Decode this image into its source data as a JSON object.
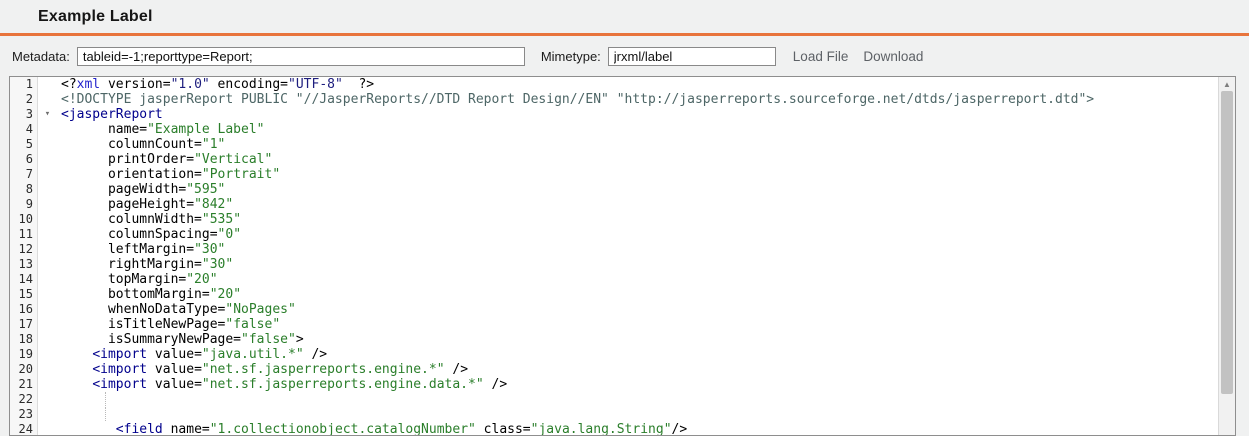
{
  "page": {
    "title": "Example Label",
    "accent_color": "#e8743c",
    "background_color": "#f0f1f1"
  },
  "toolbar": {
    "metadata_label": "Metadata:",
    "metadata_value": "tableid=-1;reporttype=Report;",
    "mimetype_label": "Mimetype:",
    "mimetype_value": "jrxml/label",
    "load_file_label": "Load File",
    "download_label": "Download"
  },
  "editor": {
    "language": "xml",
    "syntax_colors": {
      "tag": "#00008c",
      "attribute": "#000000",
      "string": "#2a7e2a",
      "doctype": "#4d6666",
      "pi_keyword": "#2323cc",
      "pi_string": "#1d1d7e",
      "plain": "#000000"
    },
    "icons": {
      "fold_arrow": "▾",
      "scroll_up": "▲"
    },
    "lines": [
      {
        "num": 1,
        "segs": [
          [
            "<?",
            "pl"
          ],
          [
            "xml",
            "pi"
          ],
          [
            " version=",
            "pl"
          ],
          [
            "\"1.0\"",
            "pistr"
          ],
          [
            " encoding=",
            "pl"
          ],
          [
            "\"UTF-8\"",
            "pistr"
          ],
          [
            "  ?>",
            "pl"
          ]
        ]
      },
      {
        "num": 2,
        "segs": [
          [
            "<!DOCTYPE jasperReport PUBLIC \"//JasperReports//DTD Report Design//EN\" \"http://jasperreports.sourceforge.net/dtds/jasperreport.dtd\">",
            "doc"
          ]
        ]
      },
      {
        "num": 3,
        "fold": true,
        "segs": [
          [
            "<jasperReport",
            "tag"
          ]
        ]
      },
      {
        "num": 4,
        "segs": [
          [
            "      name=",
            "attr"
          ],
          [
            "\"Example Label\"",
            "str"
          ]
        ]
      },
      {
        "num": 5,
        "segs": [
          [
            "      columnCount=",
            "attr"
          ],
          [
            "\"1\"",
            "str"
          ]
        ]
      },
      {
        "num": 6,
        "segs": [
          [
            "      printOrder=",
            "attr"
          ],
          [
            "\"Vertical\"",
            "str"
          ]
        ]
      },
      {
        "num": 7,
        "segs": [
          [
            "      orientation=",
            "attr"
          ],
          [
            "\"Portrait\"",
            "str"
          ]
        ]
      },
      {
        "num": 8,
        "segs": [
          [
            "      pageWidth=",
            "attr"
          ],
          [
            "\"595\"",
            "str"
          ]
        ]
      },
      {
        "num": 9,
        "segs": [
          [
            "      pageHeight=",
            "attr"
          ],
          [
            "\"842\"",
            "str"
          ]
        ]
      },
      {
        "num": 10,
        "segs": [
          [
            "      columnWidth=",
            "attr"
          ],
          [
            "\"535\"",
            "str"
          ]
        ]
      },
      {
        "num": 11,
        "segs": [
          [
            "      columnSpacing=",
            "attr"
          ],
          [
            "\"0\"",
            "str"
          ]
        ]
      },
      {
        "num": 12,
        "segs": [
          [
            "      leftMargin=",
            "attr"
          ],
          [
            "\"30\"",
            "str"
          ]
        ]
      },
      {
        "num": 13,
        "segs": [
          [
            "      rightMargin=",
            "attr"
          ],
          [
            "\"30\"",
            "str"
          ]
        ]
      },
      {
        "num": 14,
        "segs": [
          [
            "      topMargin=",
            "attr"
          ],
          [
            "\"20\"",
            "str"
          ]
        ]
      },
      {
        "num": 15,
        "segs": [
          [
            "      bottomMargin=",
            "attr"
          ],
          [
            "\"20\"",
            "str"
          ]
        ]
      },
      {
        "num": 16,
        "segs": [
          [
            "      whenNoDataType=",
            "attr"
          ],
          [
            "\"NoPages\"",
            "str"
          ]
        ]
      },
      {
        "num": 17,
        "segs": [
          [
            "      isTitleNewPage=",
            "attr"
          ],
          [
            "\"false\"",
            "str"
          ]
        ]
      },
      {
        "num": 18,
        "segs": [
          [
            "      isSummaryNewPage=",
            "attr"
          ],
          [
            "\"false\"",
            "str"
          ],
          [
            ">",
            "pl"
          ]
        ]
      },
      {
        "num": 19,
        "segs": [
          [
            "    ",
            "pl"
          ],
          [
            "<import",
            "tag"
          ],
          [
            " value=",
            "attr"
          ],
          [
            "\"java.util.*\"",
            "str"
          ],
          [
            " />",
            "pl"
          ]
        ]
      },
      {
        "num": 20,
        "segs": [
          [
            "    ",
            "pl"
          ],
          [
            "<import",
            "tag"
          ],
          [
            " value=",
            "attr"
          ],
          [
            "\"net.sf.jasperreports.engine.*\"",
            "str"
          ],
          [
            " />",
            "pl"
          ]
        ]
      },
      {
        "num": 21,
        "segs": [
          [
            "    ",
            "pl"
          ],
          [
            "<import",
            "tag"
          ],
          [
            " value=",
            "attr"
          ],
          [
            "\"net.sf.jasperreports.engine.data.*\"",
            "str"
          ],
          [
            " />",
            "pl"
          ]
        ]
      },
      {
        "num": 22,
        "guide": true,
        "segs": []
      },
      {
        "num": 23,
        "guide": true,
        "segs": []
      },
      {
        "num": 24,
        "segs": [
          [
            "       ",
            "pl"
          ],
          [
            "<field",
            "tag"
          ],
          [
            " name=",
            "attr"
          ],
          [
            "\"1.collectionobject.catalogNumber\"",
            "str"
          ],
          [
            " class=",
            "attr"
          ],
          [
            "\"java.lang.String\"",
            "str"
          ],
          [
            "/>",
            "pl"
          ]
        ]
      }
    ]
  }
}
